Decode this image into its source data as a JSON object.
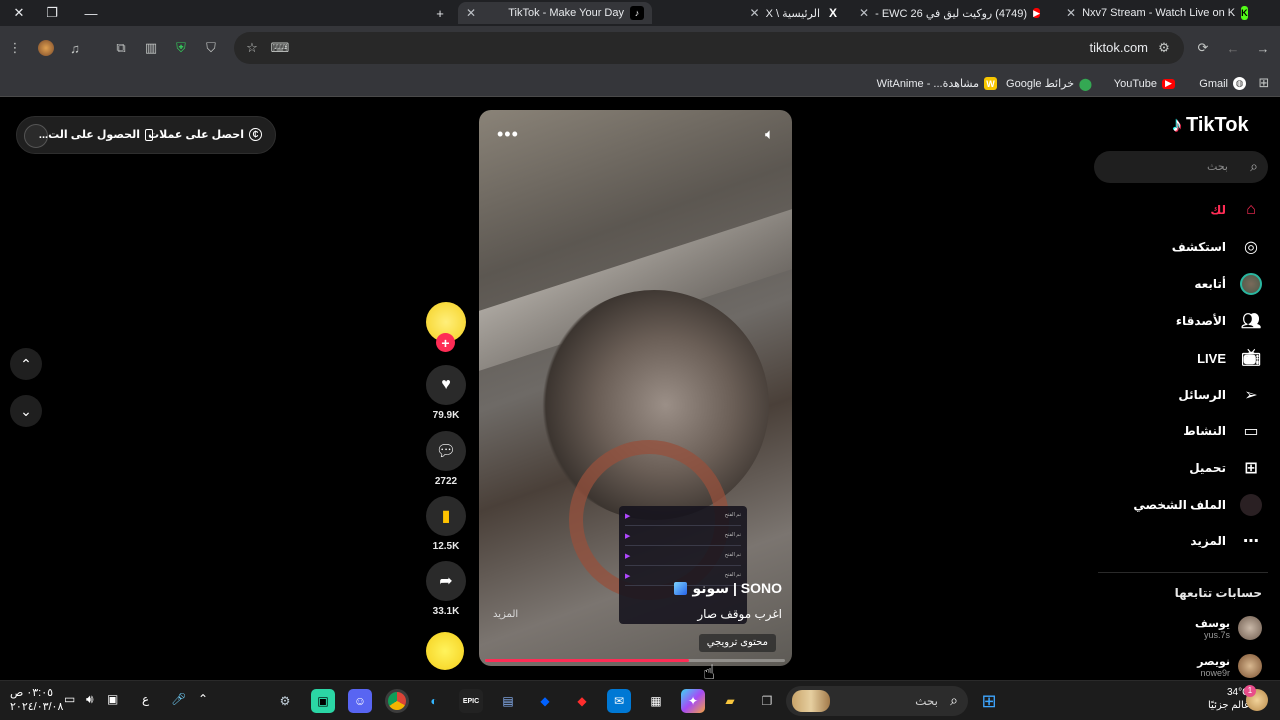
{
  "tabs": [
    {
      "title": "TikTok - Make Your Day",
      "favicon": "tiktok-icon",
      "active": true
    },
    {
      "title": "الرئيسية \\ X",
      "favicon": "x-icon"
    },
    {
      "title": "(4749) روكيت ليق في EWC 26 -",
      "favicon": "youtube-icon"
    },
    {
      "title": "Nxv7 Stream - Watch Live on K",
      "favicon": "kick-icon"
    }
  ],
  "toolbar": {
    "url": "tiktok.com"
  },
  "bookmarks": [
    {
      "label": "Gmail"
    },
    {
      "label": "YouTube"
    },
    {
      "label": "خرائط Google"
    },
    {
      "label": "مشاهدة... - WitAnime"
    }
  ],
  "promo": {
    "coins": "احصل على عملات",
    "app": "الحصول على الت..."
  },
  "video": {
    "author": "SONO | سونو",
    "caption": "اغرب موقف صار",
    "more": "المزيد",
    "badge": "محتوى ترويجي",
    "progress": 0.68,
    "overlay_rows": [
      "تم الفتح",
      "تم الفتح",
      "تم الفتح",
      "تم الفتح"
    ]
  },
  "actions": {
    "likes": "79.9K",
    "comments": "2722",
    "saves": "12.5K",
    "shares": "33.1K"
  },
  "sidebar": {
    "logo": "TikTok",
    "search_placeholder": "بحث",
    "nav": {
      "home": "لك",
      "explore": "استكشف",
      "following": "أتابعه",
      "friends": "الأصدقاء",
      "live": "LIVE",
      "messages": "الرسائل",
      "activity": "النشاط",
      "upload": "تحميل",
      "profile": "الملف الشخصي",
      "more": "المزيد"
    },
    "following_title": "حسابات تتابعها",
    "accounts": [
      {
        "name": "يوسف",
        "user": "yus.7s"
      },
      {
        "name": "نويصر",
        "user": "nowe9r"
      }
    ]
  },
  "taskbar": {
    "search_placeholder": "بحث",
    "time": "٠٣:٠٥ ص",
    "date": "٢٠٢٤/٠٣/٠٨",
    "temp": "34°C",
    "weather": "غالم جزئيًا",
    "lang": "ع",
    "notify_count": "1"
  }
}
